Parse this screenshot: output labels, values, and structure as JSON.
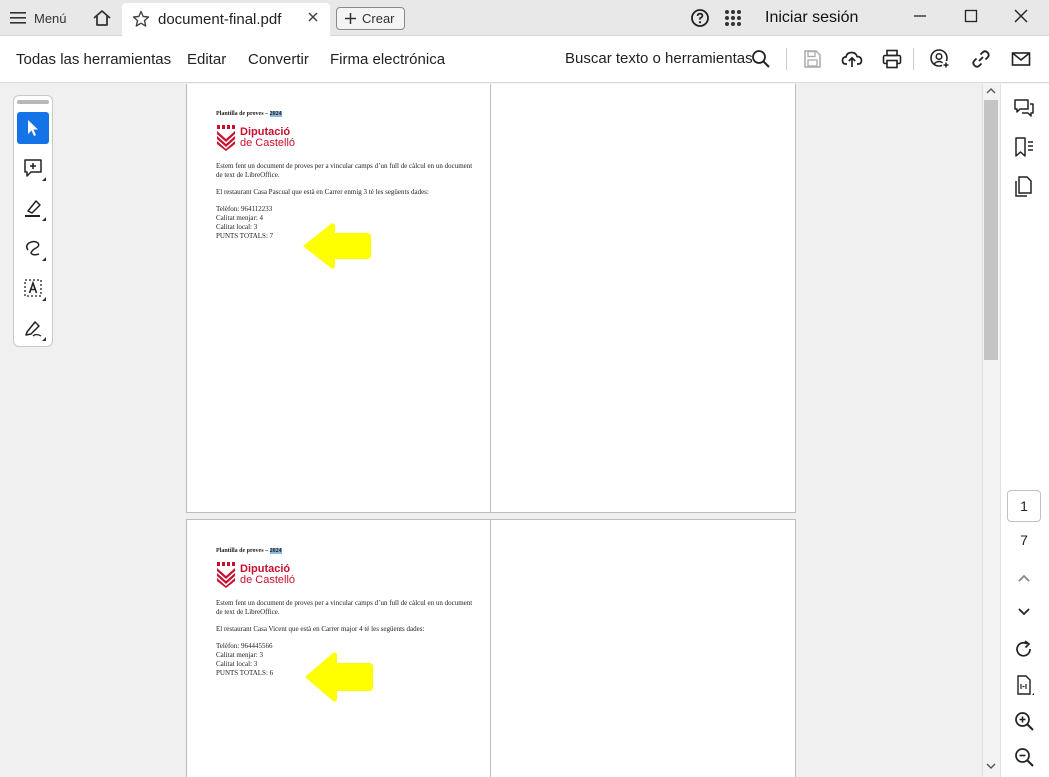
{
  "titlebar": {
    "menu_label": "Menú",
    "tab_title": "document-final.pdf",
    "create_label": "Crear",
    "signin_label": "Iniciar sesión"
  },
  "toolbar": {
    "items": [
      "Todas las herramientas",
      "Editar",
      "Convertir",
      "Firma electrónica"
    ],
    "search_label": "Buscar texto o herramientas"
  },
  "pages": [
    {
      "header": "Plantilla de proves – ",
      "header_highlight": "2024",
      "logo_line1": "Diputació",
      "logo_line2": "de Castelló",
      "intro": "Estem fent un document de proves per a vincular camps d’un full de càlcul en un document de text de LibreOffice.",
      "restaurant": "El restaurant   Casa Pascual    que està en  Carrer enmig 3   té les següents dades:",
      "phone": "Telèfon: 964112233",
      "food": "Calitat menjar: 4",
      "local": "Calitat local: 3",
      "total": "PUNTS TOTALS: 7"
    },
    {
      "header": "Plantilla de proves – ",
      "header_highlight": "2024",
      "logo_line1": "Diputació",
      "logo_line2": "de Castelló",
      "intro": "Estem fent un document de proves per a vincular camps d’un full de càlcul en un document de text de LibreOffice.",
      "restaurant": "El restaurant   Casa Vicent    que està en  Carrer major 4   té les següents dades:",
      "phone": "Telèfon: 964445566",
      "food": "Calitat menjar: 3",
      "local": "Calitat local: 3",
      "total": "PUNTS TOTALS: 6"
    }
  ],
  "pager": {
    "current": "1",
    "total": "7"
  },
  "colors": {
    "accent": "#1473e6",
    "logo_red": "#c8102e",
    "arrow_yellow": "#ffff00"
  }
}
